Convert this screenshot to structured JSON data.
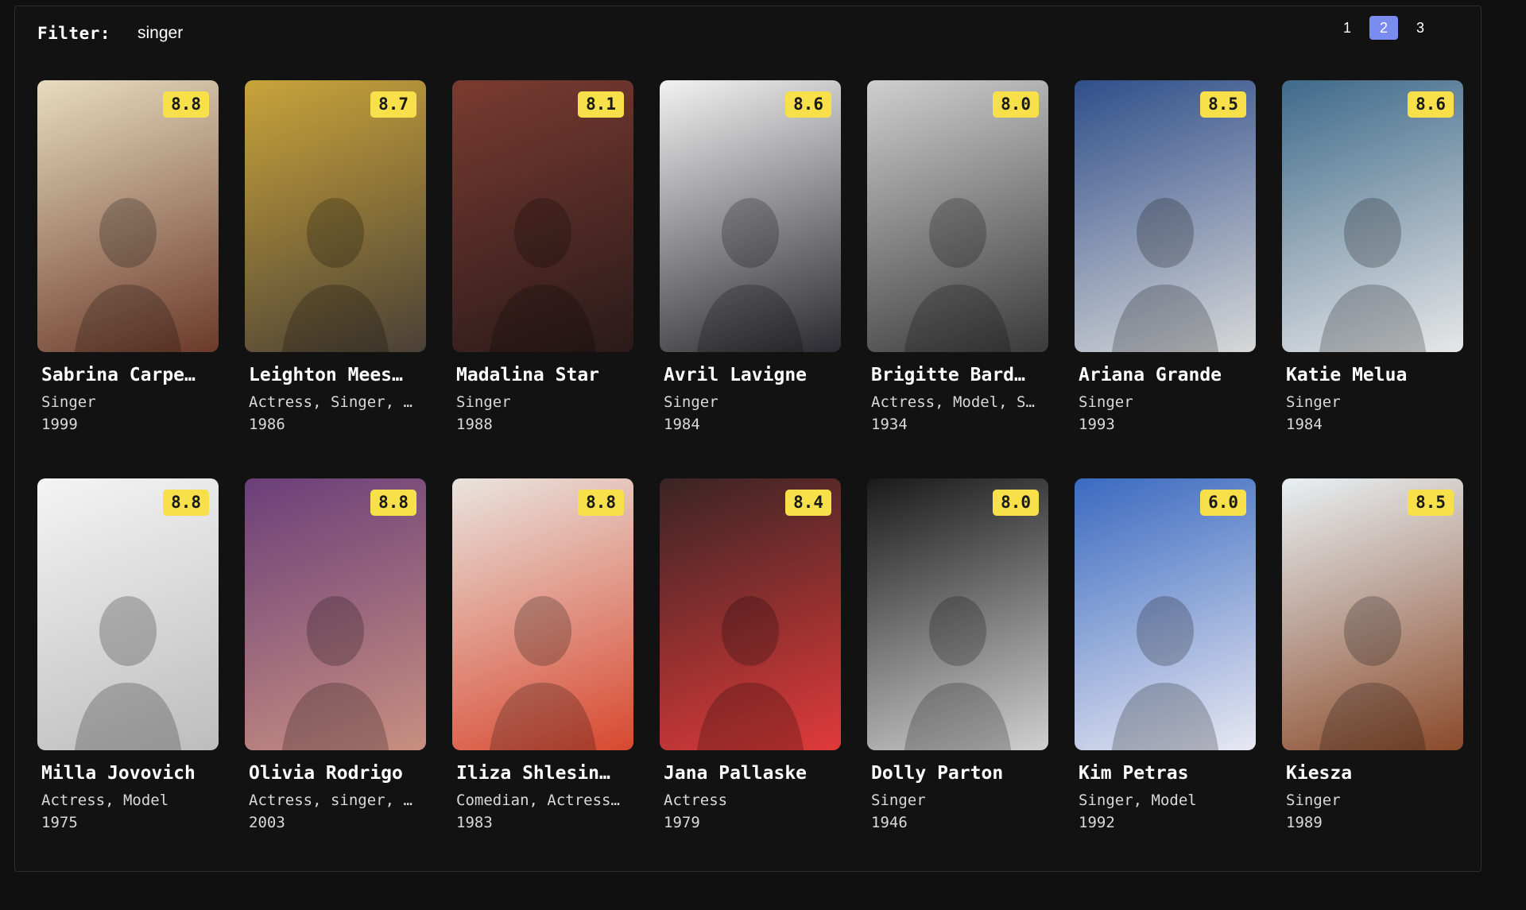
{
  "filter": {
    "label": "Filter:",
    "value": "singer"
  },
  "pagination": {
    "pages": [
      "1",
      "2",
      "3"
    ],
    "active": "2"
  },
  "colors": {
    "rating_badge": "#f7e04a",
    "active_page": "#7b8cf0",
    "background": "#101011"
  },
  "cards": [
    {
      "name": "Sabrina Carpe…",
      "role": "Singer",
      "year": "1999",
      "rating": "8.8",
      "bg": [
        "#e8dcc0",
        "#6b3a2a"
      ]
    },
    {
      "name": "Leighton Mees…",
      "role": "Actress, Singer, …",
      "year": "1986",
      "rating": "8.7",
      "bg": [
        "#c9a43a",
        "#4a4036"
      ]
    },
    {
      "name": "Madalina Star",
      "role": "Singer",
      "year": "1988",
      "rating": "8.1",
      "bg": [
        "#7a3b30",
        "#2a1a1a"
      ]
    },
    {
      "name": "Avril Lavigne",
      "role": "Singer",
      "year": "1984",
      "rating": "8.6",
      "bg": [
        "#f2f2f2",
        "#2a2a30"
      ]
    },
    {
      "name": "Brigitte Bard…",
      "role": "Actress, Model, S…",
      "year": "1934",
      "rating": "8.0",
      "bg": [
        "#cfcfcf",
        "#3a3a3a"
      ]
    },
    {
      "name": "Ariana Grande",
      "role": "Singer",
      "year": "1993",
      "rating": "8.5",
      "bg": [
        "#2f4e8a",
        "#d8d8d8"
      ]
    },
    {
      "name": "Katie Melua",
      "role": "Singer",
      "year": "1984",
      "rating": "8.6",
      "bg": [
        "#3f6a8a",
        "#e7e7e7"
      ]
    },
    {
      "name": "Milla Jovovich",
      "role": "Actress, Model",
      "year": "1975",
      "rating": "8.8",
      "bg": [
        "#f4f4f4",
        "#bdbdbd"
      ]
    },
    {
      "name": "Olivia Rodrigo",
      "role": "Actress, singer, …",
      "year": "2003",
      "rating": "8.8",
      "bg": [
        "#6a3f7a",
        "#c98f80"
      ]
    },
    {
      "name": "Iliza Shlesin…",
      "role": "Comedian, Actress…",
      "year": "1983",
      "rating": "8.8",
      "bg": [
        "#e9e4de",
        "#d8482f"
      ]
    },
    {
      "name": "Jana Pallaske",
      "role": "Actress",
      "year": "1979",
      "rating": "8.4",
      "bg": [
        "#3a2424",
        "#e03a3a"
      ]
    },
    {
      "name": "Dolly Parton",
      "role": "Singer",
      "year": "1946",
      "rating": "8.0",
      "bg": [
        "#1a1a1a",
        "#d0d0d0"
      ]
    },
    {
      "name": "Kim Petras",
      "role": "Singer, Model",
      "year": "1992",
      "rating": "6.0",
      "bg": [
        "#3a6ac0",
        "#e8e8f2"
      ]
    },
    {
      "name": "Kiesza",
      "role": "Singer",
      "year": "1989",
      "rating": "8.5",
      "bg": [
        "#e8f0f4",
        "#8a4a2a"
      ]
    }
  ]
}
